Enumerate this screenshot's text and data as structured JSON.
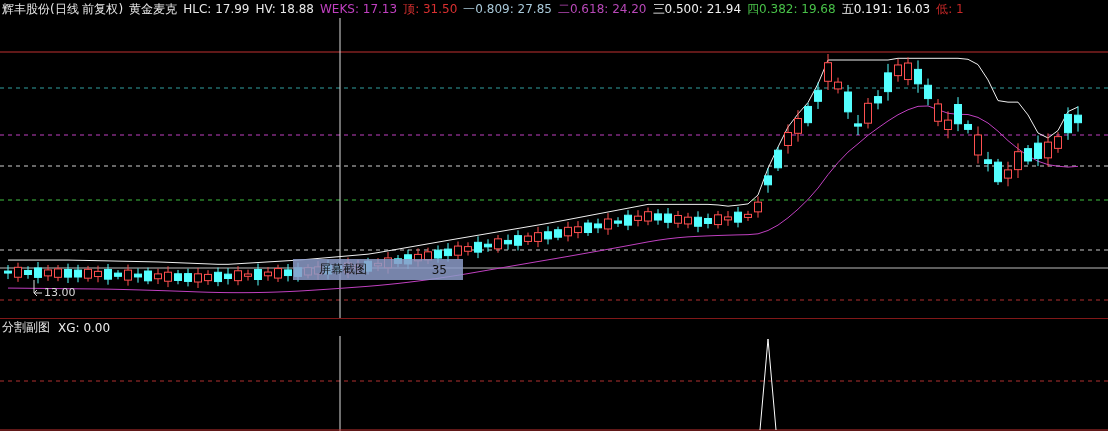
{
  "header": {
    "security": "辉丰股份(日线 前复权)",
    "formula": "黄金麦克",
    "indicators": [
      {
        "text": "HLC: 17.99",
        "color": "#e8e8e8"
      },
      {
        "text": "HV: 18.88",
        "color": "#e8e8e8"
      },
      {
        "text": "WEKS: 17.13",
        "color": "#c040c0"
      },
      {
        "text": "顶: 31.50",
        "color": "#d83030"
      },
      {
        "text": "一0.809: 27.85",
        "color": "#a8c8d8"
      },
      {
        "text": "二0.618: 24.20",
        "color": "#b848b8"
      },
      {
        "text": "三0.500: 21.94",
        "color": "#f0f0f0"
      },
      {
        "text": "四0.382: 19.68",
        "color": "#48c048"
      },
      {
        "text": "五0.191: 16.03",
        "color": "#f4f4f4"
      },
      {
        "text": "低: 1",
        "color": "#c82828"
      }
    ]
  },
  "main_chart": {
    "low_label": "13.00",
    "tooltip": {
      "label": "屏幕截图",
      "value": "35"
    }
  },
  "sub_chart": {
    "title": "分割副图",
    "indicators": [
      {
        "text": "XG: 0.00",
        "color": "#ececec"
      }
    ]
  }
}
